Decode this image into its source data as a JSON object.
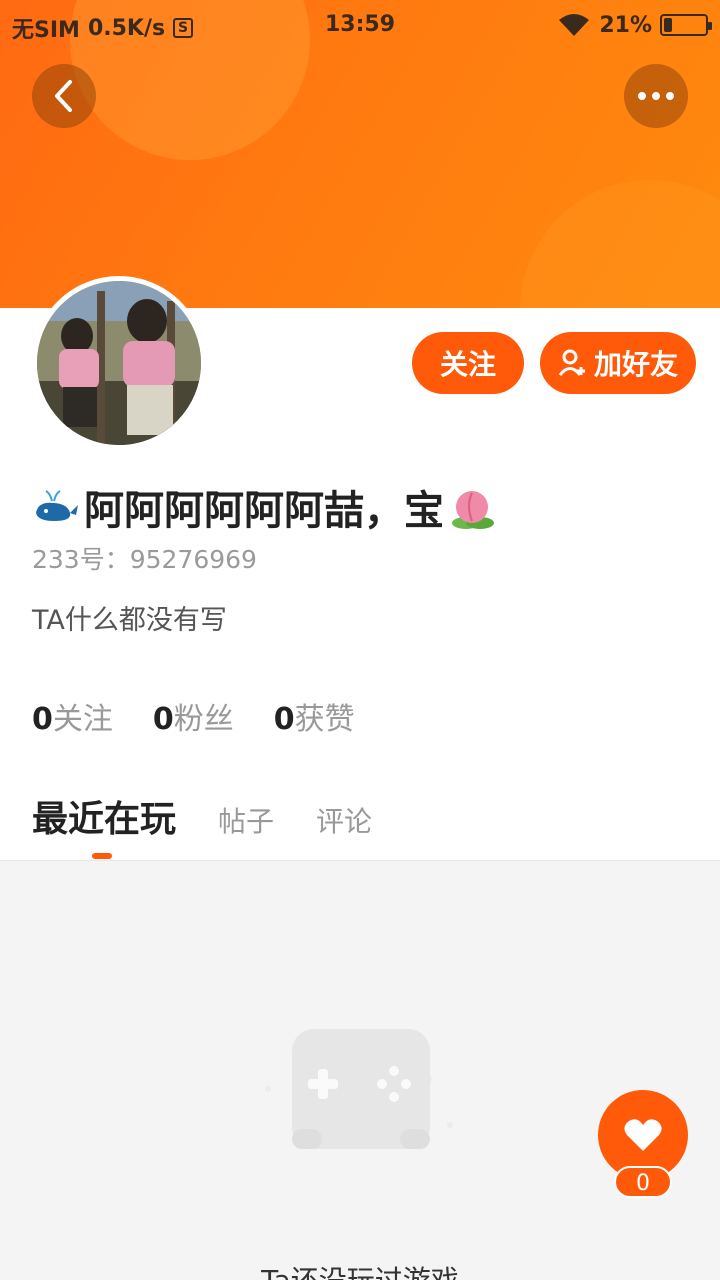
{
  "status_bar": {
    "carrier": "无SIM",
    "speed": "0.5K/s",
    "sim_icon": "S",
    "time": "13:59",
    "battery": "21%",
    "battery_level": 0.21
  },
  "header": {
    "back_icon": "chevron-left-icon",
    "more_icon": "more-horizontal-icon"
  },
  "profile": {
    "nickname": "阿阿阿阿阿阿喆，宝",
    "id_label": "233号：95276969",
    "bio": "TA什么都没有写"
  },
  "actions": {
    "follow_label": "关注",
    "add_friend_label": "加好友"
  },
  "stats": [
    {
      "count": "0",
      "label": "关注"
    },
    {
      "count": "0",
      "label": "粉丝"
    },
    {
      "count": "0",
      "label": "获赞"
    }
  ],
  "tabs": [
    {
      "label": "最近在玩",
      "active": true
    },
    {
      "label": "帖子",
      "active": false
    },
    {
      "label": "评论",
      "active": false
    }
  ],
  "empty_state": {
    "text": "Ta还没玩过游戏"
  },
  "like": {
    "count": "0"
  },
  "colors": {
    "accent": "#ff5a0a",
    "banner": "#ff7a10"
  }
}
